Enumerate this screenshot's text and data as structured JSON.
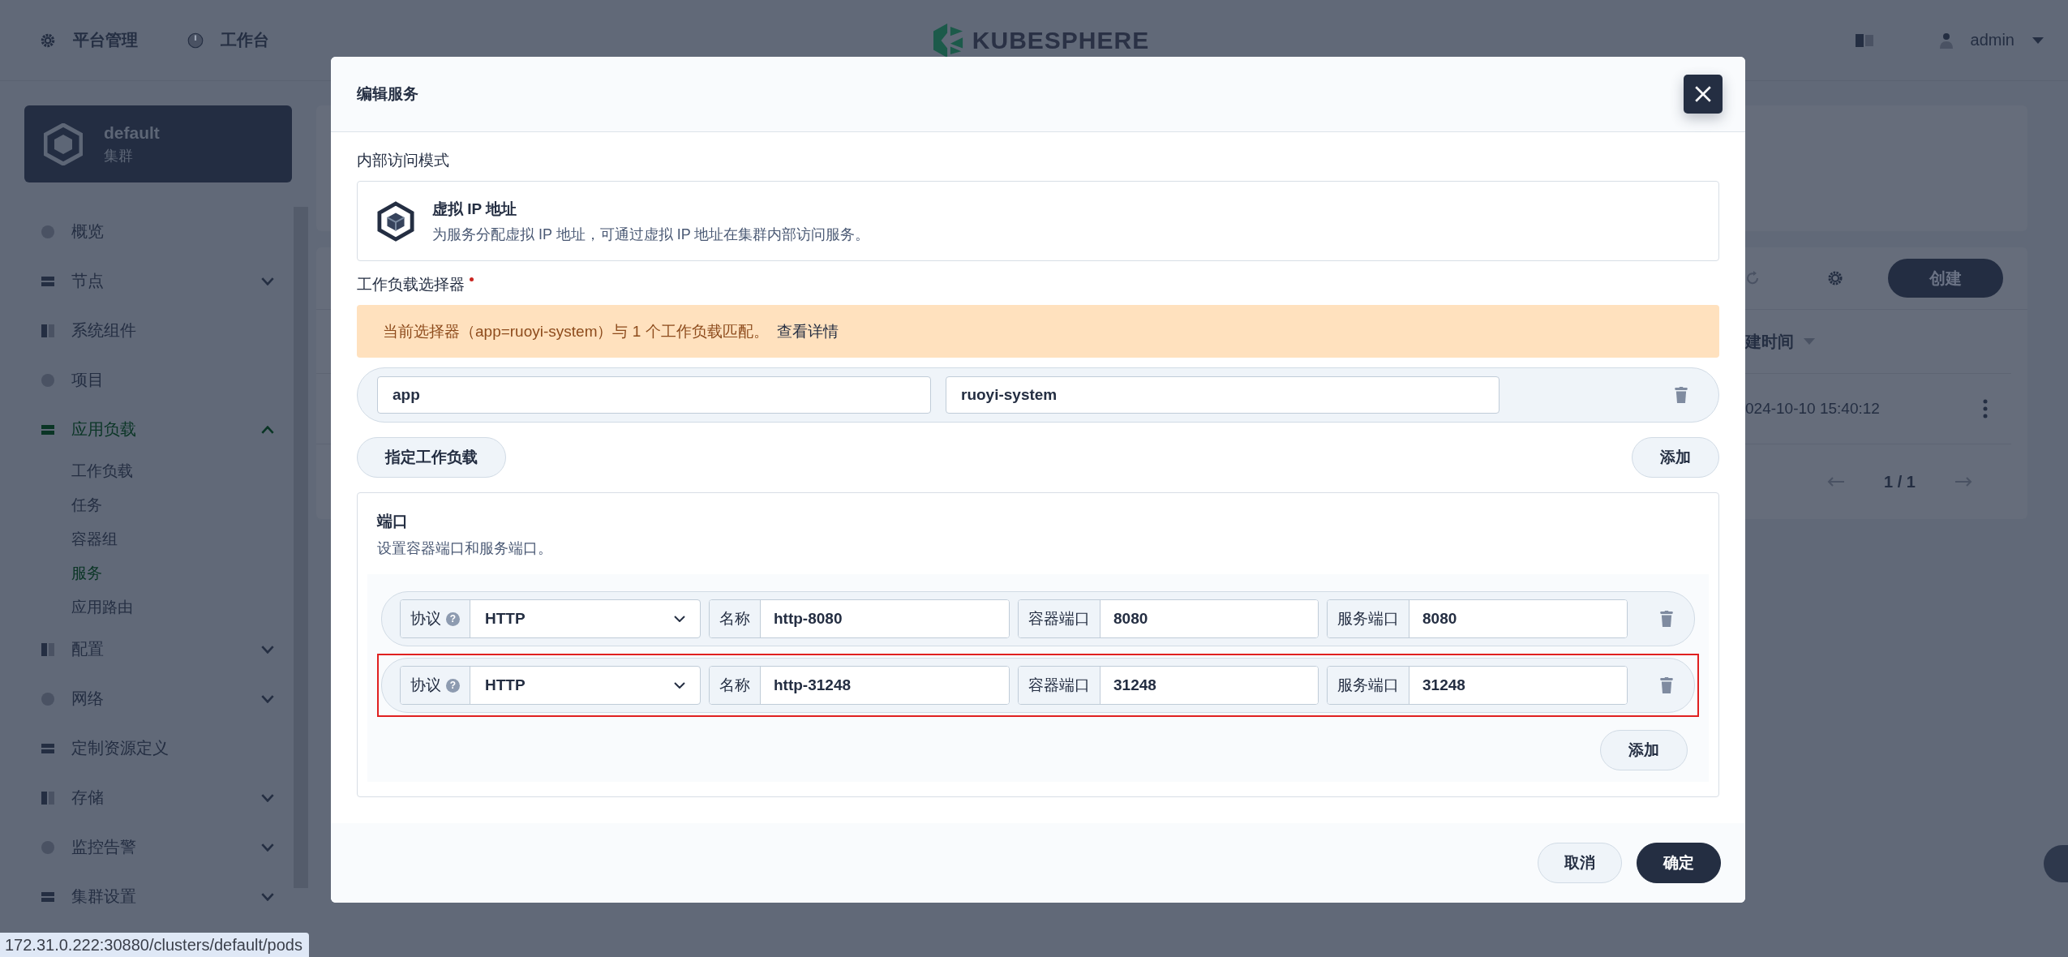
{
  "topbar": {
    "nav": [
      {
        "label": "平台管理"
      },
      {
        "label": "工作台"
      }
    ],
    "logo": "KUBESPHERE",
    "user": "admin"
  },
  "sidebar": {
    "cluster": {
      "name": "default",
      "subtitle": "集群"
    },
    "items": [
      {
        "label": "概览",
        "selected": false
      },
      {
        "label": "节点",
        "expanded": false,
        "selected": false
      },
      {
        "label": "系统组件",
        "selected": false
      },
      {
        "label": "项目",
        "selected": false
      },
      {
        "label": "应用负载",
        "expanded": true,
        "selected": true,
        "children": [
          {
            "label": "工作负载",
            "selected": false
          },
          {
            "label": "任务",
            "selected": false
          },
          {
            "label": "容器组",
            "selected": false
          },
          {
            "label": "服务",
            "selected": true
          },
          {
            "label": "应用路由",
            "selected": false
          }
        ]
      },
      {
        "label": "配置",
        "expanded": false,
        "selected": false
      },
      {
        "label": "网络",
        "expanded": false,
        "selected": false
      },
      {
        "label": "定制资源定义",
        "selected": false
      },
      {
        "label": "存储",
        "expanded": false,
        "selected": false
      },
      {
        "label": "监控告警",
        "expanded": false,
        "selected": false
      },
      {
        "label": "集群设置",
        "expanded": false,
        "selected": false
      }
    ]
  },
  "background": {
    "create_button": "创建",
    "column_header": "建时间",
    "row_time": "024-10-10 15:40:12",
    "pagination": "1 / 1"
  },
  "modal": {
    "title": "编辑服务",
    "access_mode": {
      "label": "内部访问模式",
      "title": "虚拟 IP 地址",
      "description": "为服务分配虚拟 IP 地址，可通过虚拟 IP 地址在集群内部访问服务。"
    },
    "selector": {
      "label": "工作负载选择器",
      "required": true,
      "notice": "当前选择器（app=ruoyi-system）与 1 个工作负载匹配。",
      "notice_link": "查看详情",
      "labels": [
        {
          "key": "app",
          "value": "ruoyi-system"
        }
      ],
      "assign_button": "指定工作负载",
      "add_button": "添加"
    },
    "ports": {
      "title": "端口",
      "description": "设置容器端口和服务端口。",
      "rows": [
        {
          "protocol_label": "协议",
          "help": "?",
          "protocol": "HTTP",
          "name_label": "名称",
          "name": "http-8080",
          "container_port_label": "容器端口",
          "container_port": "8080",
          "service_port_label": "服务端口",
          "service_port": "8080",
          "highlighted": false
        },
        {
          "protocol_label": "协议",
          "help": "?",
          "protocol": "HTTP",
          "name_label": "名称",
          "name": "http-31248",
          "container_port_label": "容器端口",
          "container_port": "31248",
          "service_port_label": "服务端口",
          "service_port": "31248",
          "highlighted": true
        }
      ],
      "add_button": "添加"
    },
    "buttons": {
      "cancel": "取消",
      "confirm": "确定"
    }
  },
  "status_url": "172.31.0.222:30880/clusters/default/pods"
}
